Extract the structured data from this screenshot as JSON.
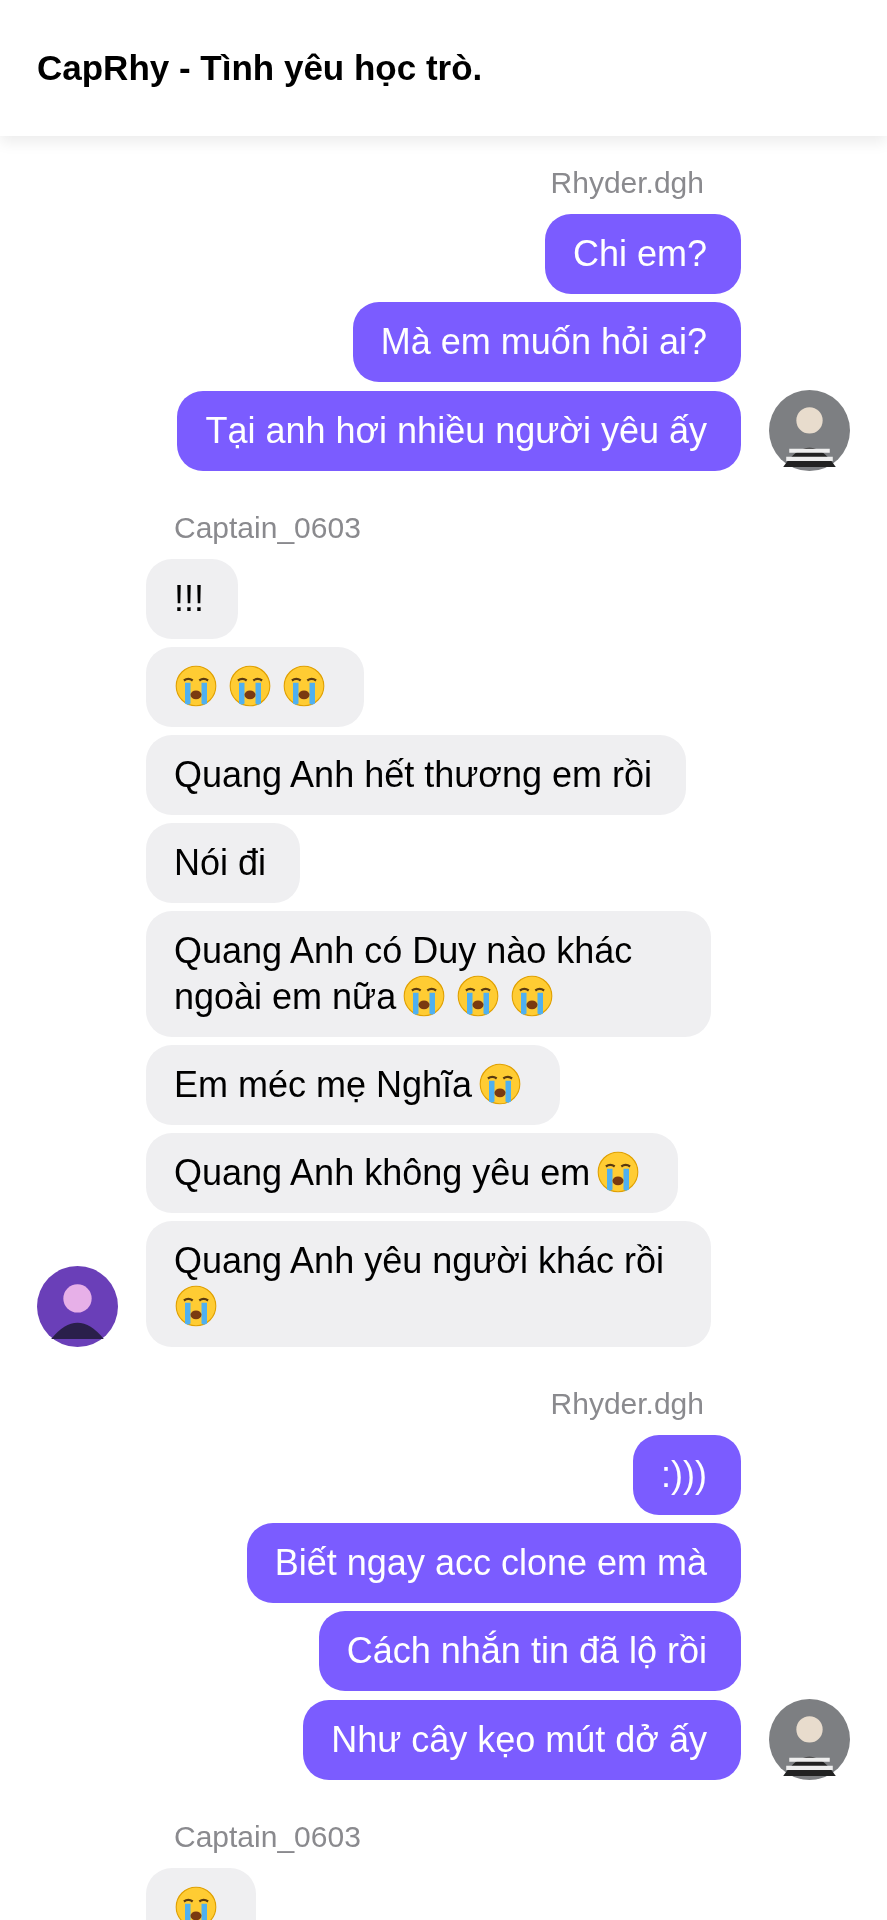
{
  "header": {
    "title": "CapRhy - Tình yêu học trò."
  },
  "groups": [
    {
      "sender": "Rhyder.dgh",
      "outgoing": true,
      "avatar_shown": true,
      "messages": [
        {
          "parts": [
            {
              "kind": "text",
              "text": "Chi em?"
            }
          ]
        },
        {
          "parts": [
            {
              "kind": "text",
              "text": "Mà em muốn hỏi ai?"
            }
          ]
        },
        {
          "parts": [
            {
              "kind": "text",
              "text": "Tại anh hơi nhiều người yêu ấy"
            }
          ]
        }
      ]
    },
    {
      "sender": "Captain_0603",
      "outgoing": false,
      "avatar_shown": true,
      "messages": [
        {
          "parts": [
            {
              "kind": "text",
              "text": "!!!"
            }
          ]
        },
        {
          "parts": [
            {
              "kind": "emoji"
            },
            {
              "kind": "emoji"
            },
            {
              "kind": "emoji"
            }
          ]
        },
        {
          "parts": [
            {
              "kind": "text",
              "text": "Quang Anh hết thương em rồi"
            }
          ]
        },
        {
          "parts": [
            {
              "kind": "text",
              "text": "Nói đi"
            }
          ]
        },
        {
          "parts": [
            {
              "kind": "text",
              "text": "Quang Anh có Duy nào khác ngoài em nữa"
            },
            {
              "kind": "emoji"
            },
            {
              "kind": "emoji"
            },
            {
              "kind": "emoji"
            }
          ]
        },
        {
          "parts": [
            {
              "kind": "text",
              "text": "Em méc mẹ Nghĩa"
            },
            {
              "kind": "emoji"
            }
          ]
        },
        {
          "parts": [
            {
              "kind": "text",
              "text": "Quang Anh không yêu em"
            },
            {
              "kind": "emoji"
            }
          ]
        },
        {
          "parts": [
            {
              "kind": "text",
              "text": "Quang Anh yêu người khác rồi"
            },
            {
              "kind": "emoji"
            }
          ]
        }
      ]
    },
    {
      "sender": "Rhyder.dgh",
      "outgoing": true,
      "avatar_shown": true,
      "messages": [
        {
          "parts": [
            {
              "kind": "text",
              "text": ":)))"
            }
          ]
        },
        {
          "parts": [
            {
              "kind": "text",
              "text": "Biết ngay acc clone em mà"
            }
          ]
        },
        {
          "parts": [
            {
              "kind": "text",
              "text": "Cách nhắn tin đã lộ rồi"
            }
          ]
        },
        {
          "parts": [
            {
              "kind": "text",
              "text": "Như cây kẹo mút dở ấy"
            }
          ]
        }
      ]
    },
    {
      "sender": "Captain_0603",
      "outgoing": false,
      "avatar_shown": false,
      "messages": [
        {
          "parts": [
            {
              "kind": "emoji"
            }
          ]
        }
      ]
    }
  ]
}
